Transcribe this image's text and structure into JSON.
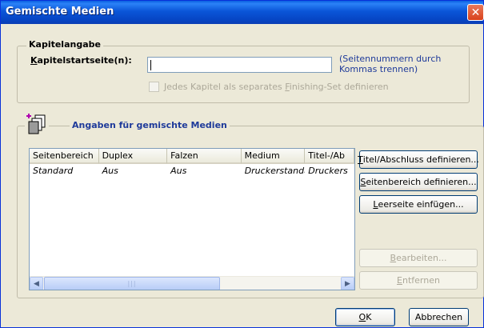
{
  "window": {
    "title": "Gemischte Medien"
  },
  "chapter_group": {
    "title": "Kapitelangabe",
    "start_label_prefix": "",
    "start_label_mnemonic": "K",
    "start_label_rest": "apitelstartseite(n):",
    "input_value": "",
    "hint_line1": "(Seitennummern durch",
    "hint_line2": "Kommas trennen)",
    "checkbox_label_a": "Jedes Kapitel als separates ",
    "checkbox_label_mnemonic": "F",
    "checkbox_label_b": "inishing-Set definieren",
    "checkbox_checked": false
  },
  "media_group": {
    "title": "Angaben für gemischte Medien",
    "columns": [
      "Seitenbereich",
      "Duplex",
      "Falzen",
      "Medium",
      "Titel-/Ab"
    ],
    "rows": [
      {
        "seitenbereich": "Standard",
        "duplex": "Aus",
        "falzen": "Aus",
        "medium": "Druckerstandard",
        "titel": "Druckers"
      }
    ],
    "buttons": {
      "titel_mn": "T",
      "titel_rest": "itel/Abschluss definieren...",
      "seiten_mn": "S",
      "seiten_rest": "eitenbereich definieren...",
      "leer_mn": "L",
      "leer_rest": "eerseite einfügen...",
      "bearb_mn": "B",
      "bearb_rest": "earbeiten...",
      "entf_mn": "E",
      "entf_rest": "ntfernen"
    }
  },
  "footer": {
    "ok_mn": "O",
    "ok_rest": "K",
    "cancel_label": "Abbrechen"
  },
  "colors": {
    "title_bar": "#0a55d8",
    "dialog_bg": "#ece9d8",
    "group_title_blue": "#1e3a9a"
  }
}
